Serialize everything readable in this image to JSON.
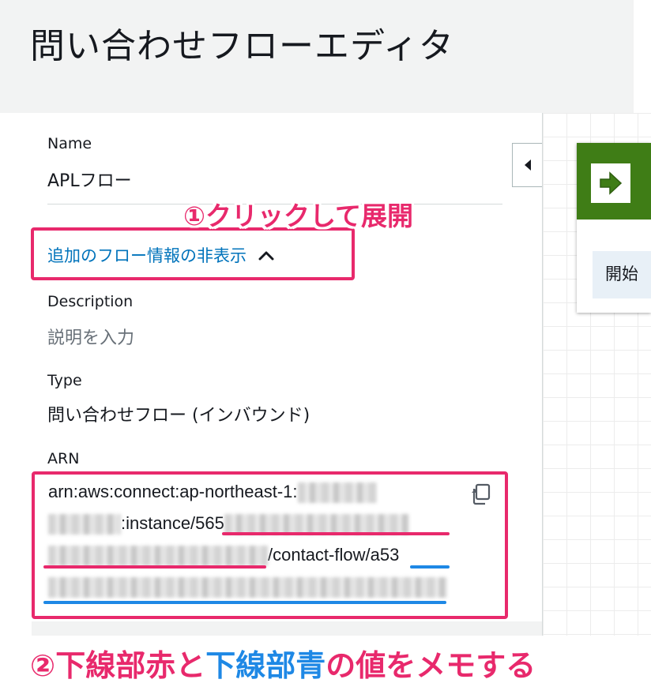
{
  "page": {
    "title": "問い合わせフローエディタ"
  },
  "panel": {
    "name_label": "Name",
    "name_value": "APLフロー",
    "toggle_link": "追加のフロー情報の非表示",
    "description_label": "Description",
    "description_placeholder": "説明を入力",
    "type_label": "Type",
    "type_value": "問い合わせフロー (インバウンド)",
    "arn_label": "ARN",
    "arn_prefix": "arn:aws:connect:ap-northeast-1:",
    "arn_instance": ":instance/",
    "arn_instance_start": "565",
    "arn_contact_flow": "/contact-flow/",
    "arn_flow_start": "a53"
  },
  "canvas": {
    "start_block_label": "開始"
  },
  "annotations": {
    "step1": "①クリックして展開",
    "step2_prefix": "②",
    "step2_red": "下線部赤",
    "step2_and": "と",
    "step2_blue": "下線部青",
    "step2_suffix": "の値をメモする",
    "colors": {
      "pink": "#e8296c",
      "red": "#e8296c",
      "blue": "#1e88e5",
      "link": "#0073bb",
      "green": "#3f7d16"
    }
  },
  "icons": [
    "chevron-up-icon",
    "copy-icon",
    "collapse-left-icon",
    "arrow-right-icon"
  ]
}
